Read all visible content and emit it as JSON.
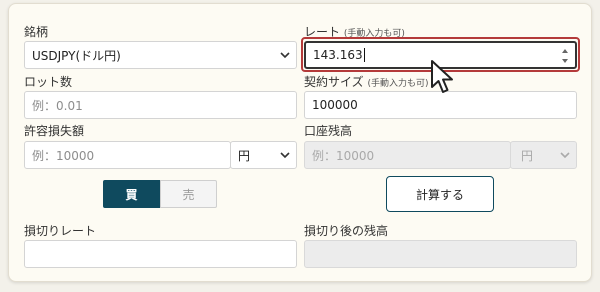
{
  "form": {
    "pair_label": "銘柄",
    "pair_value": "USDJPY(ドル円)",
    "rate_label": "レート",
    "rate_note": "(手動入力も可)",
    "rate_value": "143.163",
    "lot_label": "ロット数",
    "lot_placeholder": "例：0.01",
    "contract_label": "契約サイズ",
    "contract_note": "(手動入力も可)",
    "contract_value": "100000",
    "loss_label": "許容損失額",
    "loss_placeholder": "例：10000",
    "loss_currency": "円",
    "balance_label": "口座残高",
    "balance_placeholder": "例：10000",
    "balance_currency": "円",
    "buy_label": "買",
    "sell_label": "売",
    "calc_label": "計算する",
    "stop_rate_label": "損切りレート",
    "after_balance_label": "損切り後の残高",
    "stop_rate_value": "",
    "after_balance_value": ""
  },
  "icons": {
    "select_arrow": "chevron-down-icon",
    "spinner": "spinner-arrows-icon",
    "cursor": "mouse-pointer-icon"
  },
  "colors": {
    "accent": "#0f4a5e",
    "highlight": "#b43a3a",
    "panel_bg": "#fdfbf3"
  }
}
